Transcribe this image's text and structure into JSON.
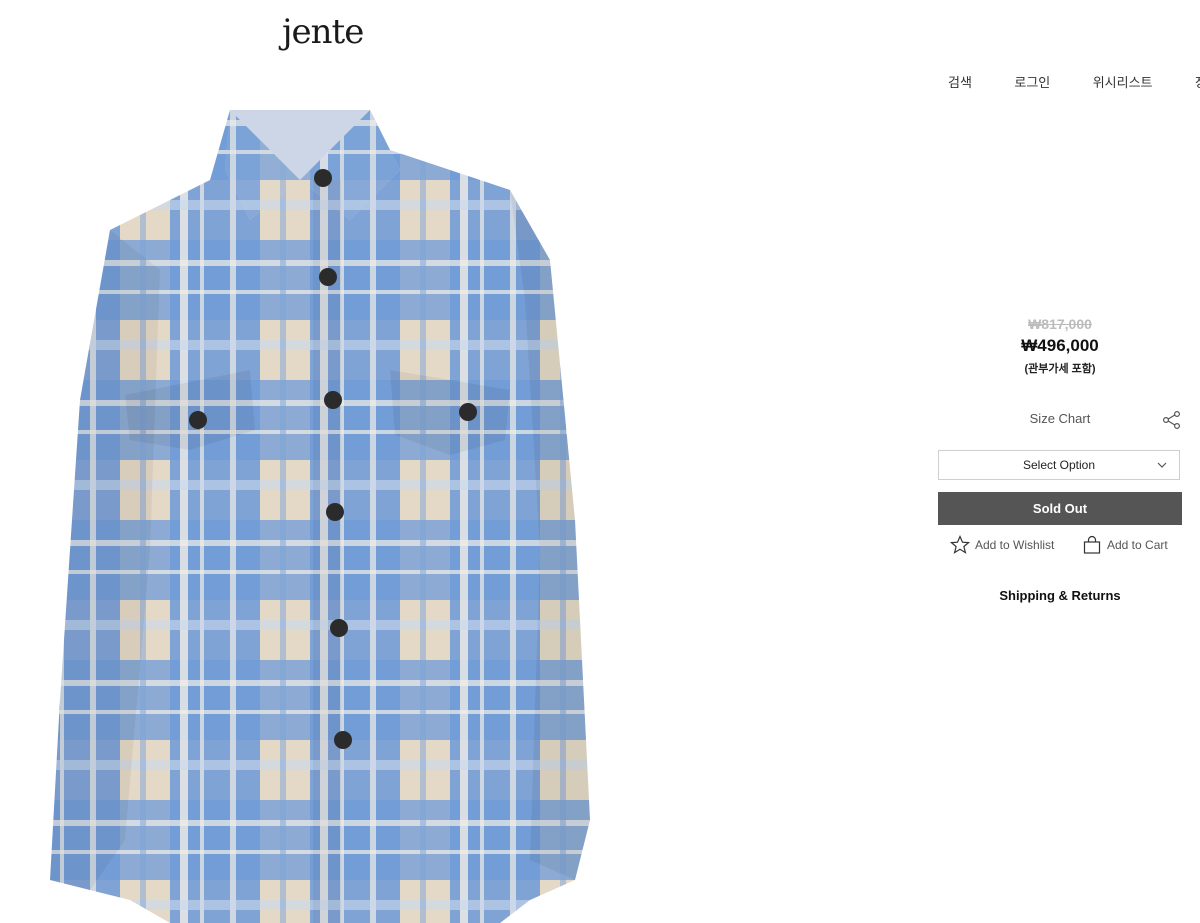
{
  "header": {
    "logo": "jente",
    "nav": [
      "검색",
      "로그인",
      "위시리스트",
      "장"
    ]
  },
  "product": {
    "original_price": "₩817,000",
    "sale_price": "₩496,000",
    "tax_note": "(관부가세 포함)",
    "size_chart_label": "Size Chart",
    "select_option_label": "Select Option",
    "sold_out_label": "Sold Out",
    "wishlist_label": "Add to Wishlist",
    "cart_label": "Add to Cart",
    "shipping_label": "Shipping & Returns"
  },
  "colors": {
    "sold_out_bg": "#555555",
    "shirt_blue": "#6b97d6",
    "shirt_cream": "#e6dccb"
  }
}
